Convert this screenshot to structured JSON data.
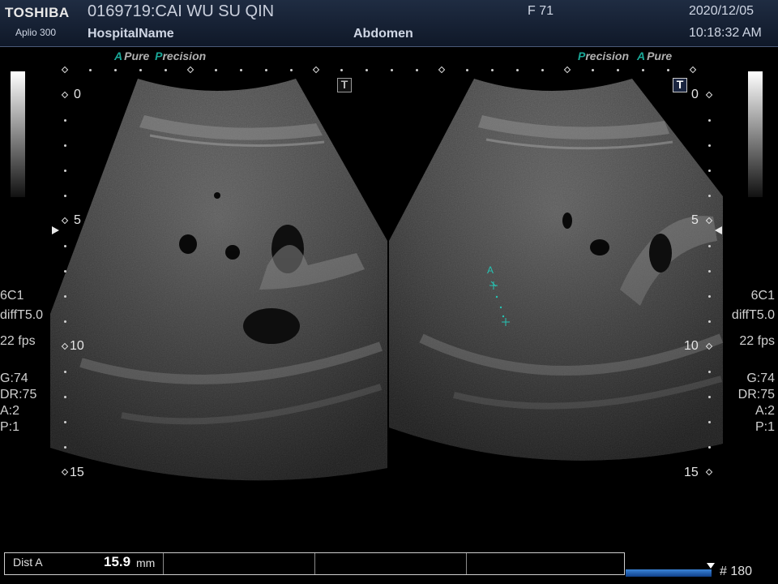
{
  "header": {
    "brand": "TOSHIBA",
    "model": "Aplio 300",
    "patient": "0169719:CAI WU SU QIN",
    "hospital": "HospitalName",
    "sex_age": "F  71",
    "exam": "Abdomen",
    "date": "2020/12/05",
    "time": "10:18:32 AM"
  },
  "left_image": {
    "tag_a": "A",
    "tag_pure": "Pure",
    "tag_p": "P",
    "tag_precision": "recision",
    "depth_labels": [
      "0",
      "5",
      "10",
      "15"
    ]
  },
  "right_image": {
    "tag_p": "P",
    "tag_precision": "recision",
    "tag_a": "A",
    "tag_pure": "Pure",
    "depth_labels": [
      "0",
      "5",
      "10",
      "15"
    ],
    "caliper_label": "A"
  },
  "left_params": {
    "transducer": "6C1",
    "mode": "diffT5.0",
    "fps": "22 fps",
    "gain": "G:74",
    "dynamic_range": "DR:75",
    "a": "A:2",
    "p": "P:1"
  },
  "right_params": {
    "transducer": "6C1",
    "mode": "diffT5.0",
    "fps": "22 fps",
    "gain": "G:74",
    "dynamic_range": "DR:75",
    "a": "A:2",
    "p": "P:1"
  },
  "measurement": {
    "label": "Dist A",
    "value": "15.9",
    "unit": "mm"
  },
  "cine": {
    "frame": "# 180",
    "progress": 1.0
  },
  "colors": {
    "accent_teal": "#1aa898",
    "header_bg": "#1f2c42",
    "cine_blue": "#2a6cc8"
  },
  "icons": {
    "left_t": "T",
    "right_t": "T"
  }
}
